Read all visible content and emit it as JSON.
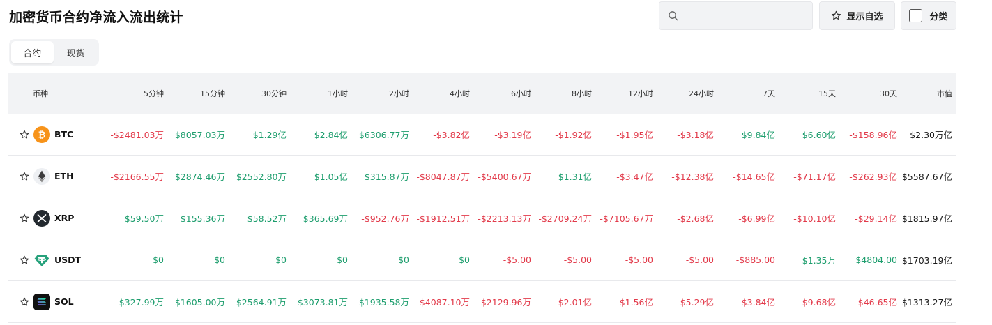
{
  "page": {
    "title": "加密货币合约净流入流出统计"
  },
  "search": {
    "placeholder": ""
  },
  "toolbar": {
    "favorites_label": "显示自选",
    "category_label": "分类"
  },
  "tabs": [
    {
      "label": "合约",
      "active": true
    },
    {
      "label": "现货",
      "active": false
    }
  ],
  "colors": {
    "positive": "#1e9e6e",
    "negative": "#e23a4a"
  },
  "table": {
    "headers": [
      "币种",
      "5分钟",
      "15分钟",
      "30分钟",
      "1小时",
      "2小时",
      "4小时",
      "6小时",
      "8小时",
      "12小时",
      "24小时",
      "7天",
      "15天",
      "30天",
      "市值"
    ],
    "rows": [
      {
        "symbol": "BTC",
        "icon": "bitcoin-icon",
        "values": [
          "-$2481.03万",
          "$8057.03万",
          "$1.29亿",
          "$2.84亿",
          "$6306.77万",
          "-$3.82亿",
          "-$3.19亿",
          "-$1.92亿",
          "-$1.95亿",
          "-$3.18亿",
          "$9.84亿",
          "$6.60亿",
          "-$158.96亿"
        ],
        "market_cap": "$2.30万亿"
      },
      {
        "symbol": "ETH",
        "icon": "ethereum-icon",
        "values": [
          "-$2166.55万",
          "$2874.46万",
          "$2552.80万",
          "$1.05亿",
          "$315.87万",
          "-$8047.87万",
          "-$5400.67万",
          "$1.31亿",
          "-$3.47亿",
          "-$12.38亿",
          "-$14.65亿",
          "-$71.17亿",
          "-$262.93亿"
        ],
        "market_cap": "$5587.67亿"
      },
      {
        "symbol": "XRP",
        "icon": "xrp-icon",
        "values": [
          "$59.50万",
          "$155.36万",
          "$58.52万",
          "$365.69万",
          "-$952.76万",
          "-$1912.51万",
          "-$2213.13万",
          "-$2709.24万",
          "-$7105.67万",
          "-$2.68亿",
          "-$6.99亿",
          "-$10.10亿",
          "-$29.14亿"
        ],
        "market_cap": "$1815.97亿"
      },
      {
        "symbol": "USDT",
        "icon": "tether-icon",
        "values": [
          "$0",
          "$0",
          "$0",
          "$0",
          "$0",
          "$0",
          "-$5.00",
          "-$5.00",
          "-$5.00",
          "-$5.00",
          "-$885.00",
          "$1.35万",
          "$4804.00"
        ],
        "market_cap": "$1703.19亿"
      },
      {
        "symbol": "SOL",
        "icon": "solana-icon",
        "values": [
          "$327.99万",
          "$1605.00万",
          "$2564.91万",
          "$3073.81万",
          "$1935.58万",
          "-$4087.10万",
          "-$2129.96万",
          "-$2.01亿",
          "-$1.56亿",
          "-$5.29亿",
          "-$3.84亿",
          "-$9.68亿",
          "-$46.65亿"
        ],
        "market_cap": "$1313.27亿"
      }
    ]
  }
}
